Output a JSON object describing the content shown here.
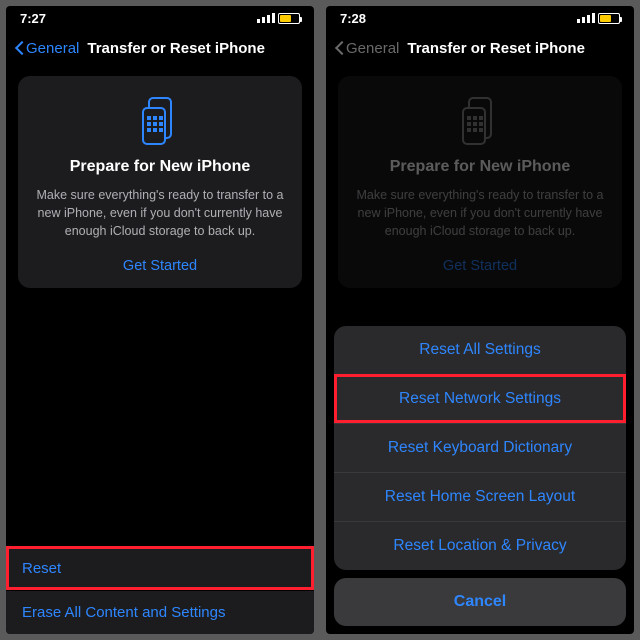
{
  "left": {
    "time": "7:27",
    "nav_back": "General",
    "nav_title": "Transfer or Reset iPhone",
    "card_title": "Prepare for New iPhone",
    "card_body": "Make sure everything's ready to transfer to a new iPhone, even if you don't currently have enough iCloud storage to back up.",
    "card_link": "Get Started",
    "row_reset": "Reset",
    "row_erase": "Erase All Content and Settings"
  },
  "right": {
    "time": "7:28",
    "nav_back": "General",
    "nav_title": "Transfer or Reset iPhone",
    "card_title": "Prepare for New iPhone",
    "card_body": "Make sure everything's ready to transfer to a new iPhone, even if you don't currently have enough iCloud storage to back up.",
    "card_link": "Get Started",
    "sheet": {
      "reset_all": "Reset All Settings",
      "reset_network": "Reset Network Settings",
      "reset_keyboard": "Reset Keyboard Dictionary",
      "reset_home": "Reset Home Screen Layout",
      "reset_location": "Reset Location & Privacy",
      "cancel": "Cancel"
    }
  },
  "colors": {
    "accent": "#2e86ff",
    "highlight": "#ff1f2f",
    "card_bg": "#1c1c1e",
    "sheet_bg": "#2a2a2c"
  }
}
